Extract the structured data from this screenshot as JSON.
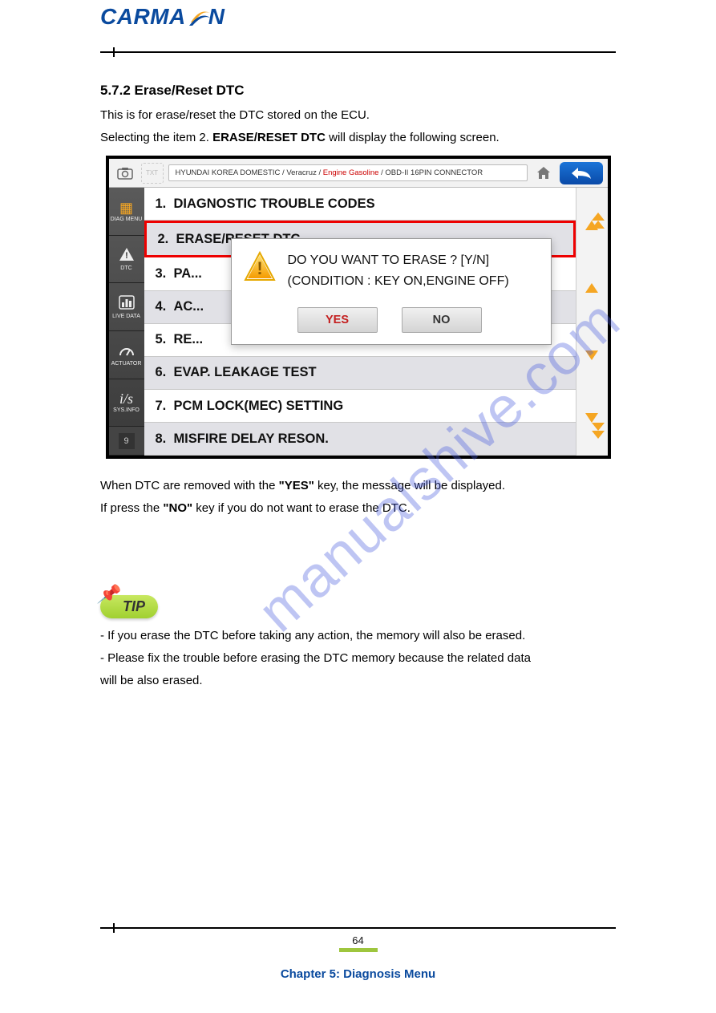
{
  "header": {
    "logo_text": "CARMAN"
  },
  "section": {
    "title": "5.7.2 Erase/Reset DTC",
    "intro1": "This is for erase/reset the DTC stored on the ECU.",
    "intro2_prefix": "Selecting the item 2. ",
    "intro2_bold": "ERASE/RESET DTC",
    "intro2_suffix": " will display the following screen."
  },
  "figure": {
    "path_parts": [
      "HYUNDAI KOREA DOMESTIC / Veracruz / ",
      "Engine Gasoline",
      " / OBD-II 16PIN CONNECTOR"
    ],
    "sidebar": [
      {
        "label": "DIAG MENU"
      },
      {
        "label": "DTC"
      },
      {
        "label": "LIVE DATA"
      },
      {
        "label": "ACTUATOR"
      },
      {
        "label": "SYS.INFO"
      }
    ],
    "sidebar_count": "9",
    "list": [
      {
        "n": "1.",
        "t": "DIAGNOSTIC TROUBLE CODES"
      },
      {
        "n": "2.",
        "t": "ERASE/RESET DTC"
      },
      {
        "n": "3.",
        "t": "PA..."
      },
      {
        "n": "4.",
        "t": "AC..."
      },
      {
        "n": "5.",
        "t": "RE..."
      },
      {
        "n": "6.",
        "t": "EVAP. LEAKAGE TEST"
      },
      {
        "n": "7.",
        "t": "PCM LOCK(MEC) SETTING"
      },
      {
        "n": "8.",
        "t": "MISFIRE DELAY RESON."
      }
    ],
    "dialog": {
      "line1": "DO YOU WANT TO ERASE ? [Y/N]",
      "line2": "(CONDITION : KEY ON,ENGINE OFF)",
      "yes": "YES",
      "no": "NO"
    }
  },
  "below": {
    "p1_a": "When DTC are removed with the ",
    "p1_b": "\"YES\"",
    "p1_c": " key, the message will be displayed.",
    "p2_a": "If press the ",
    "p2_b": "\"NO\"",
    "p2_c": " key if you do not want to erase the DTC."
  },
  "tip": {
    "label": "TIP",
    "line1": "- If you erase the DTC before taking any action, the memory will also be erased.",
    "line2": "- Please fix the trouble before erasing the DTC memory because the related data",
    "line3": "will be also erased."
  },
  "watermark": "manualshive.com",
  "footer": {
    "pagenum": "64",
    "chapter": "Chapter 5: Diagnosis Menu"
  }
}
